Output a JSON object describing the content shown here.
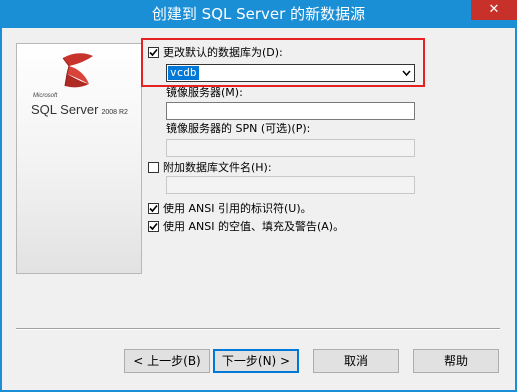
{
  "window": {
    "title": "创建到 SQL Server 的新数据源",
    "close_glyph": "✕"
  },
  "logo": {
    "microsoft": "Microsoft",
    "product": "SQL Server",
    "version": "2008 R2"
  },
  "form": {
    "change_default_db": {
      "label": "更改默认的数据库为(D):",
      "checked": true,
      "value": "vcdb"
    },
    "mirror_server": {
      "label": "镜像服务器(M):",
      "value": ""
    },
    "mirror_spn": {
      "label": "镜像服务器的 SPN (可选)(P):",
      "value": ""
    },
    "attach_db_file": {
      "label": "附加数据库文件名(H):",
      "checked": false,
      "value": ""
    },
    "ansi_quoted": {
      "label": "使用 ANSI 引用的标识符(U)。",
      "checked": true
    },
    "ansi_nulls": {
      "label": "使用 ANSI 的空值、填充及警告(A)。",
      "checked": true
    }
  },
  "buttons": {
    "back": "< 上一步(B)",
    "next": "下一步(N) >",
    "cancel": "取消",
    "help": "帮助"
  },
  "colors": {
    "title_bar": "#1a8fd6",
    "close": "#c7312a",
    "selection": "#0078d7",
    "highlight_border": "#e52121"
  }
}
